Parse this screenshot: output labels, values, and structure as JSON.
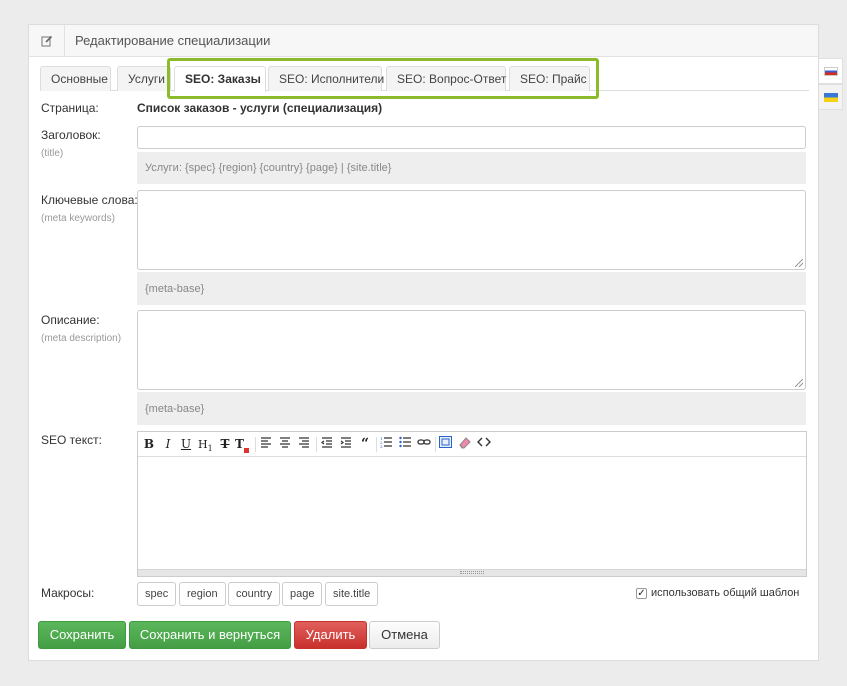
{
  "header": {
    "title": "Редактирование специализации",
    "icon": "edit-icon"
  },
  "languages": [
    {
      "name": "ru",
      "icon": "flag-ru-icon",
      "active": true
    },
    {
      "name": "ua",
      "icon": "flag-ua-icon",
      "active": false
    }
  ],
  "tabs": [
    {
      "label": "Основные"
    },
    {
      "label": "Услуги"
    },
    {
      "label": "SEO: Заказы",
      "active": true
    },
    {
      "label": "SEO: Исполнители"
    },
    {
      "label": "SEO: Вопрос-Ответ"
    },
    {
      "label": "SEO: Прайс"
    }
  ],
  "form": {
    "page_label": "Страница:",
    "page_value": "Список заказов - услуги (специализация)",
    "title_label": "Заголовок:",
    "title_sub": "(title)",
    "title_value": "",
    "title_hint": "Услуги: {spec} {region} {country} {page} | {site.title}",
    "keywords_label": "Ключевые слова:",
    "keywords_sub": "(meta keywords)",
    "keywords_value": "",
    "keywords_hint": "{meta-base}",
    "description_label": "Описание:",
    "description_sub": "(meta description)",
    "description_value": "",
    "description_hint": "{meta-base}",
    "seo_text_label": "SEO текст:",
    "macros_label": "Макросы:",
    "macros": [
      "spec",
      "region",
      "country",
      "page",
      "site.title"
    ],
    "use_common_template_label": "использовать общий шаблон",
    "use_common_template_checked": true
  },
  "editor_toolbar": {
    "bold": "B",
    "italic": "I",
    "underline": "U",
    "heading": "H",
    "font": "T",
    "quote": "“"
  },
  "buttons": {
    "save": "Сохранить",
    "save_and_return": "Сохранить и вернуться",
    "delete": "Удалить",
    "cancel": "Отмена"
  },
  "colors": {
    "highlight": "#8bbb2a",
    "save": "#5cb85c",
    "delete": "#d9534f"
  }
}
